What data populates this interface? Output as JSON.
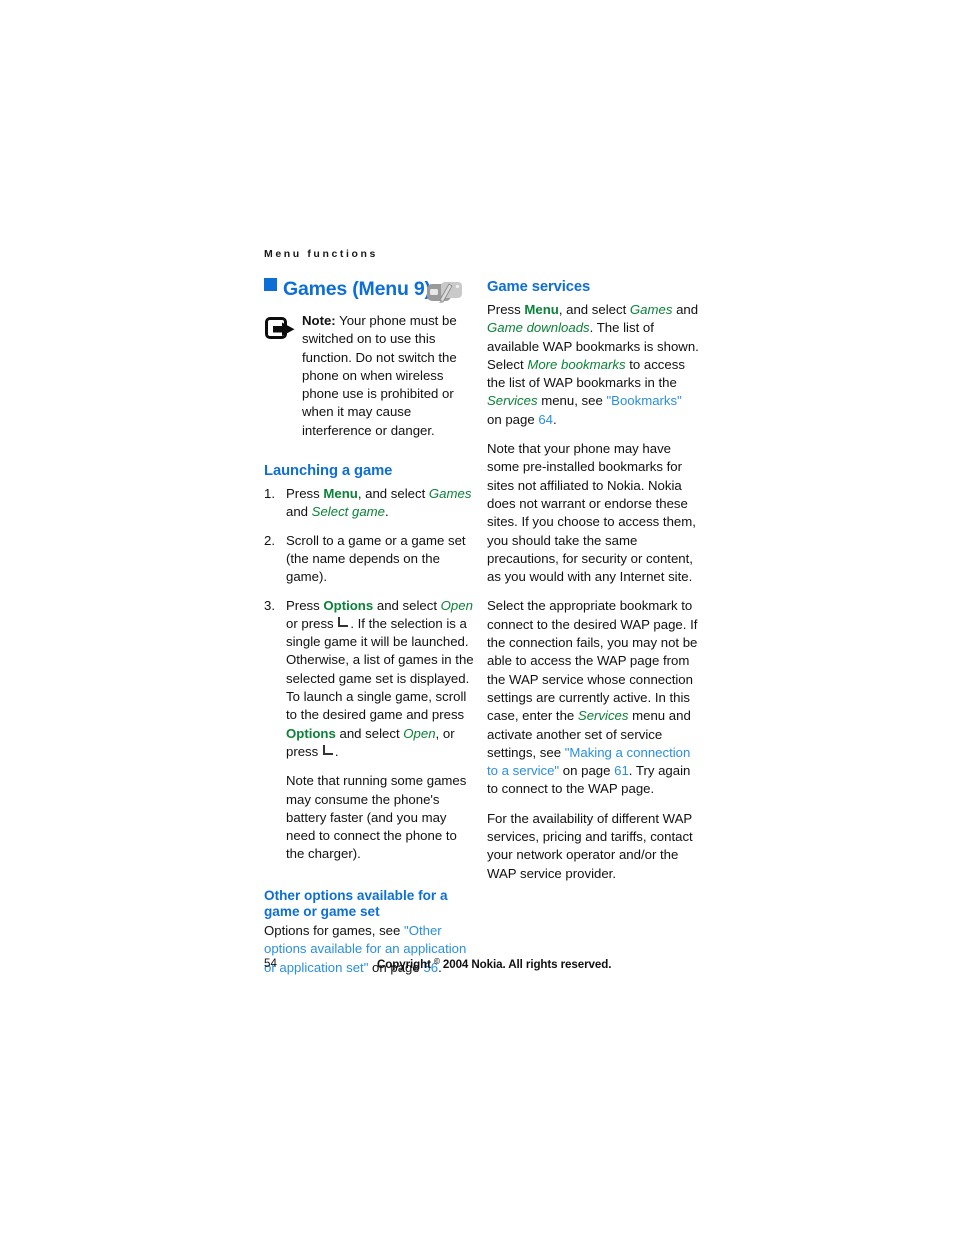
{
  "running_header": "Menu functions",
  "chapter": {
    "bullet_color": "#0d6fd6",
    "title": "Games (Menu 9)",
    "icon_name": "games-controller-icon"
  },
  "note": {
    "icon_name": "note-arrow-icon",
    "label": "Note:",
    "text": " Your phone must be switched on to use this function. Do not switch the phone on when wireless phone use is prohibited or when it may cause interference or danger."
  },
  "left_column": {
    "launching_heading": "Launching a game",
    "steps": [
      {
        "num": "1.",
        "parts": [
          {
            "t": "Press ",
            "style": "plain"
          },
          {
            "t": "Menu",
            "style": "ui-bold"
          },
          {
            "t": ", and select ",
            "style": "plain"
          },
          {
            "t": "Games",
            "style": "ui-ital"
          },
          {
            "t": " and ",
            "style": "plain"
          },
          {
            "t": "Select game",
            "style": "ui-ital"
          },
          {
            "t": ".",
            "style": "plain"
          }
        ]
      },
      {
        "num": "2.",
        "parts": [
          {
            "t": "Scroll to a game or a game set (the name depends on the game).",
            "style": "plain"
          }
        ]
      },
      {
        "num": "3.",
        "parts": [
          {
            "t": "Press ",
            "style": "plain"
          },
          {
            "t": "Options",
            "style": "ui-bold"
          },
          {
            "t": " and select ",
            "style": "plain"
          },
          {
            "t": "Open",
            "style": "ui-ital"
          },
          {
            "t": " or press ",
            "style": "plain"
          },
          {
            "t": "└",
            "style": "keysym"
          },
          {
            "t": ". If the selection is a single game it will be launched.",
            "style": "plain"
          }
        ]
      }
    ],
    "step3_para2_a": "Otherwise, a list of games in the selected game set is displayed. To launch a single game, scroll to the desired game and press ",
    "step3_para2_options": "Options",
    "step3_para2_b": " and select ",
    "step3_para2_open": "Open",
    "step3_para2_c": ", or press ",
    "step3_para2_d": ".",
    "step3_para3": "Note that running some games may consume the phone's battery faster (and you may need to connect the phone to the charger).",
    "other_options_heading": "Other options available for a game or game set",
    "other_options_a": "Options for games, see ",
    "other_options_link": "\"Other options available for an application or application set\"",
    "other_options_b": " on page ",
    "other_options_page": "56",
    "other_options_c": "."
  },
  "right_column": {
    "game_services_heading": "Game services",
    "gs_p1_a": "Press ",
    "gs_p1_menu": "Menu",
    "gs_p1_b": ", and select ",
    "gs_p1_games": "Games",
    "gs_p1_c": " and ",
    "gs_p1_downloads": "Game downloads",
    "gs_p1_d": ". The list of available WAP bookmarks is shown. Select ",
    "gs_p1_more": "More bookmarks",
    "gs_p1_e": " to access the list of WAP bookmarks in the ",
    "gs_p1_services": "Services",
    "gs_p1_f": " menu, see ",
    "gs_p1_link": "\"Bookmarks\"",
    "gs_p1_g": " on page ",
    "gs_p1_page": "64",
    "gs_p1_h": ".",
    "gs_p2": "Note that your phone may have some pre-installed bookmarks for sites not affiliated to Nokia. Nokia does not warrant or endorse these sites. If you choose to access them, you should take the same precautions, for security or content, as you would with any Internet site.",
    "gs_p3_a": "Select the appropriate bookmark to connect to the desired WAP page. If the connection fails, you may not be able to access the WAP page from the WAP service whose connection settings are currently active. In this case, enter the ",
    "gs_p3_services": "Services",
    "gs_p3_b": " menu and activate another set of service settings, see ",
    "gs_p3_link": "\"Making a connection to a service\"",
    "gs_p3_c": " on page ",
    "gs_p3_page": "61",
    "gs_p3_d": ". Try again to connect to the WAP page.",
    "gs_p4": "For the availability of different WAP services, pricing and tariffs, contact your network operator and/or the WAP service provider."
  },
  "footer": {
    "page_number": "54",
    "copyright_pre": "Copyright ",
    "copyright_mark": "©",
    "copyright_post": " 2004 Nokia. All rights reserved."
  },
  "colors": {
    "heading_blue": "#0d6fd6",
    "link_blue": "#2a8fe0",
    "ui_green": "#0a8237",
    "body_black": "#111111"
  }
}
